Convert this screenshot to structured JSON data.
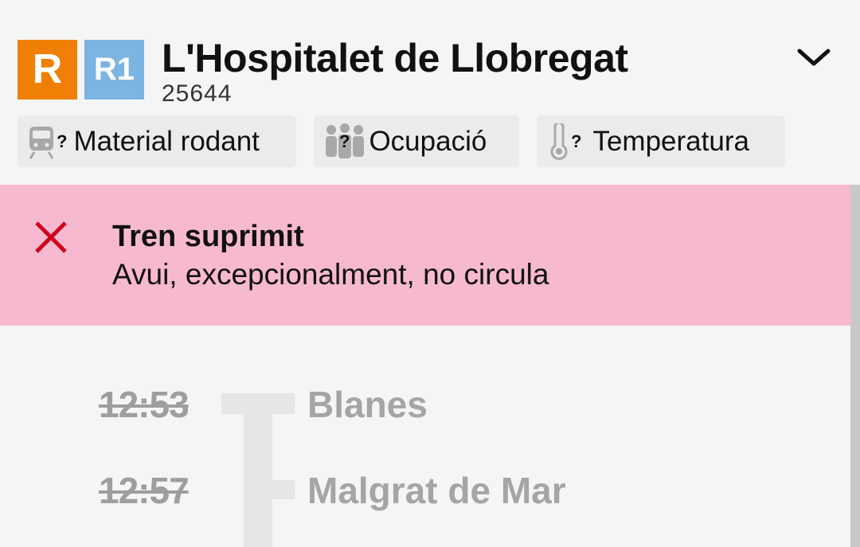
{
  "header": {
    "operator_logo": "R",
    "line_logo": "R1",
    "station": "L'Hospitalet de Llobregat",
    "train_number": "25644",
    "colors": {
      "operator": "#f07f05",
      "line": "#7cb5e2"
    }
  },
  "chips": [
    {
      "icon": "train-icon",
      "qualifier": "?",
      "label": "Material rodant"
    },
    {
      "icon": "people-icon",
      "qualifier": "?",
      "label": "Ocupació"
    },
    {
      "icon": "thermometer-icon",
      "qualifier": "?",
      "label": "Temperatura"
    }
  ],
  "alert": {
    "icon": "close-icon",
    "title": "Tren suprimit",
    "message": "Avui, excepcionalment, no circula",
    "background": "#f7b9d0",
    "icon_color": "#d0021b"
  },
  "stops": [
    {
      "time": "12:53",
      "name": "Blanes"
    },
    {
      "time": "12:57",
      "name": "Malgrat de Mar"
    }
  ]
}
